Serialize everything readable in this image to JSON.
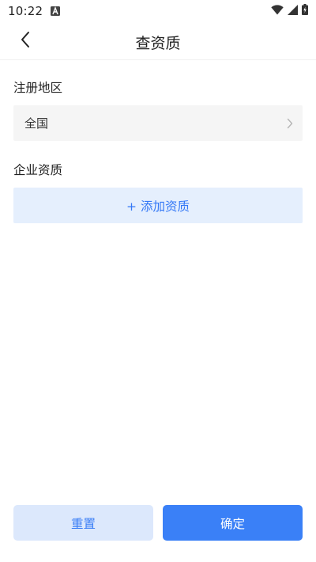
{
  "status_bar": {
    "time": "10:22",
    "icons": [
      "a-notification-icon",
      "wifi-icon",
      "signal-icon",
      "battery-icon"
    ]
  },
  "header": {
    "title": "查资质",
    "back_icon": "chevron-left-icon"
  },
  "filters": {
    "region_label": "注册地区",
    "region_value": "全国",
    "region_icon": "chevron-right-icon",
    "qualification_label": "企业资质",
    "add_qualification_label": "+ 添加资质"
  },
  "footer": {
    "reset_label": "重置",
    "confirm_label": "确定"
  },
  "colors": {
    "accent": "#3a80f7",
    "accent_light": "#e5effd",
    "field_bg": "#f5f5f5"
  }
}
